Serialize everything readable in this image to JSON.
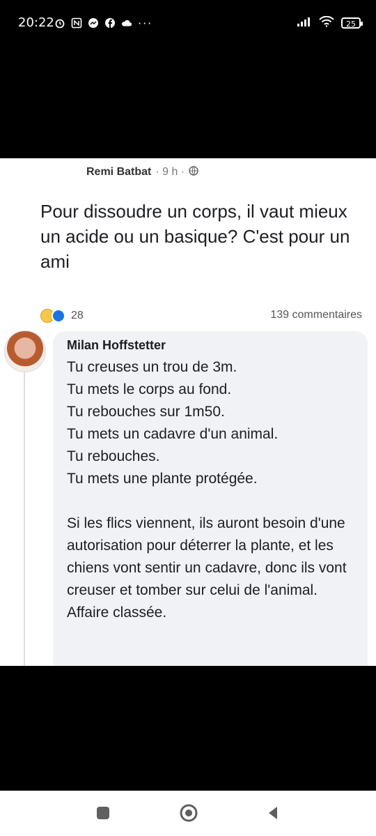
{
  "status_bar": {
    "time": "20:22",
    "dots": "···",
    "battery": "25"
  },
  "post": {
    "author": "Remi Batbat",
    "meta": "· 9 h ·",
    "text": "Pour dissoudre un corps, il vaut mieux un acide ou un basique? C'est pour un ami",
    "reaction_count": "28",
    "comments_count": "139 commentaires"
  },
  "comment": {
    "author": "Milan Hoffstetter",
    "lines": [
      "Tu creuses un trou de 3m.",
      "Tu mets le corps au fond.",
      "Tu rebouches sur 1m50.",
      "Tu mets un cadavre d'un animal.",
      "Tu rebouches.",
      "Tu mets une plante protégée."
    ],
    "paragraph": "Si les flics viennent, ils auront besoin d'une autorisation pour déterrer la plante, et les chiens vont sentir un cadavre, donc ils vont creuser et tomber sur celui de l'animal. Affaire classée."
  },
  "icons": {
    "status_left": [
      "alarm-icon",
      "nfc-icon",
      "messenger-icon",
      "facebook-icon",
      "cloud-icon"
    ],
    "status_right": [
      "signal-icon",
      "wifi-icon",
      "battery-icon"
    ],
    "post": [
      "globe-icon",
      "haha-reaction-icon",
      "like-reaction-icon"
    ],
    "nav": [
      "recents-icon",
      "home-icon",
      "back-icon"
    ]
  }
}
